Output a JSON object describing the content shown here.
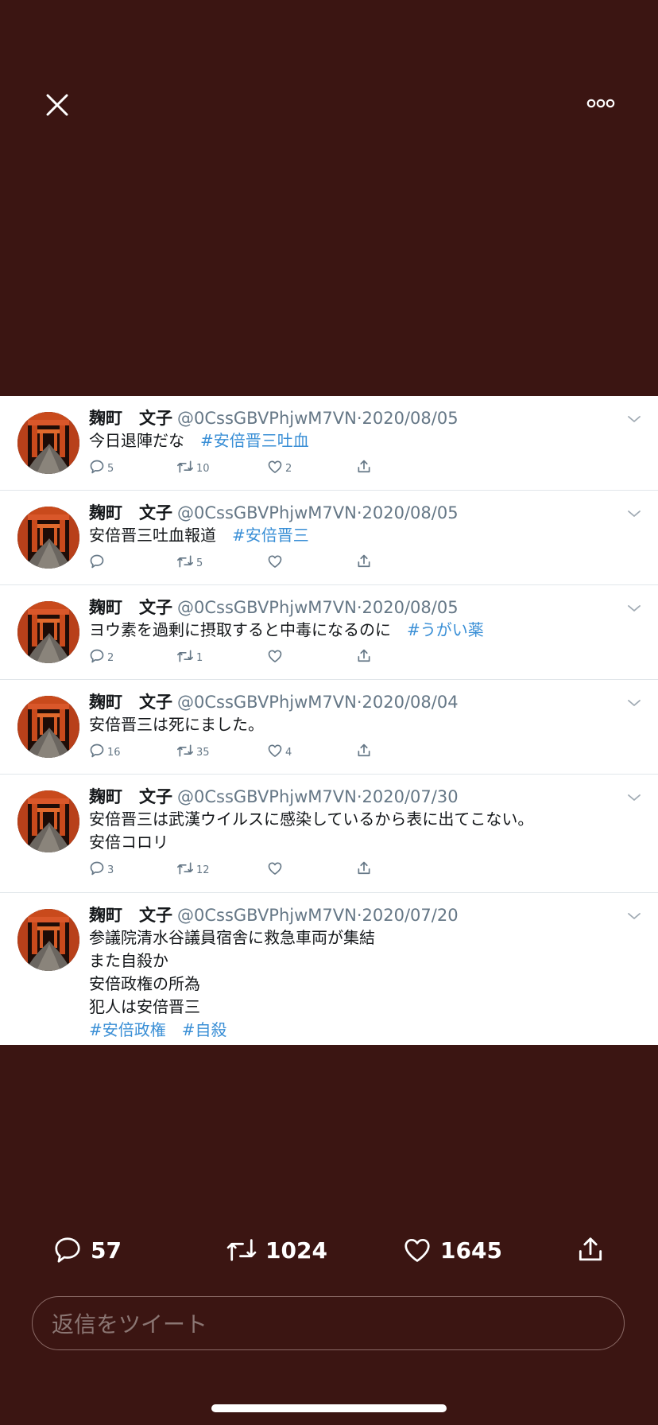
{
  "colors": {
    "background": "#3b1512",
    "hashtag": "#3a8fd6",
    "secondary": "#657786"
  },
  "topbar": {
    "close_icon": "close-icon",
    "more_icon": "more-icon"
  },
  "tweets": [
    {
      "name": "麹町　文子",
      "handle": "@0CssGBVPhjwM7VN",
      "date": "2020/08/05",
      "lines": [
        [
          "今日退陣だな　",
          "#安倍晋三吐血"
        ]
      ],
      "replies": "5",
      "retweets": "10",
      "likes": "2"
    },
    {
      "name": "麹町　文子",
      "handle": "@0CssGBVPhjwM7VN",
      "date": "2020/08/05",
      "lines": [
        [
          "安倍晋三吐血報道　",
          "#安倍晋三"
        ]
      ],
      "replies": "",
      "retweets": "5",
      "likes": ""
    },
    {
      "name": "麹町　文子",
      "handle": "@0CssGBVPhjwM7VN",
      "date": "2020/08/05",
      "lines": [
        [
          "ヨウ素を過剰に摂取すると中毒になるのに　",
          "#うがい薬"
        ]
      ],
      "replies": "2",
      "retweets": "1",
      "likes": ""
    },
    {
      "name": "麹町　文子",
      "handle": "@0CssGBVPhjwM7VN",
      "date": "2020/08/04",
      "lines": [
        [
          "安倍晋三は死にました。"
        ]
      ],
      "replies": "16",
      "retweets": "35",
      "likes": "4"
    },
    {
      "name": "麹町　文子",
      "handle": "@0CssGBVPhjwM7VN",
      "date": "2020/07/30",
      "lines": [
        [
          "安倍晋三は武漢ウイルスに感染しているから表に出てこない。"
        ],
        [
          "安倍コロリ"
        ]
      ],
      "replies": "3",
      "retweets": "12",
      "likes": ""
    },
    {
      "name": "麹町　文子",
      "handle": "@0CssGBVPhjwM7VN",
      "date": "2020/07/20",
      "lines": [
        [
          "参議院清水谷議員宿舎に救急車両が集結"
        ],
        [
          "また自殺か"
        ],
        [
          "安倍政権の所為"
        ],
        [
          "犯人は安倍晋三"
        ],
        [
          "",
          "#安倍政権　#自殺"
        ]
      ],
      "replies": "",
      "retweets": "",
      "likes": ""
    }
  ],
  "bottom": {
    "replies": "57",
    "retweets": "1024",
    "likes": "1645",
    "reply_placeholder": "返信をツイート"
  }
}
